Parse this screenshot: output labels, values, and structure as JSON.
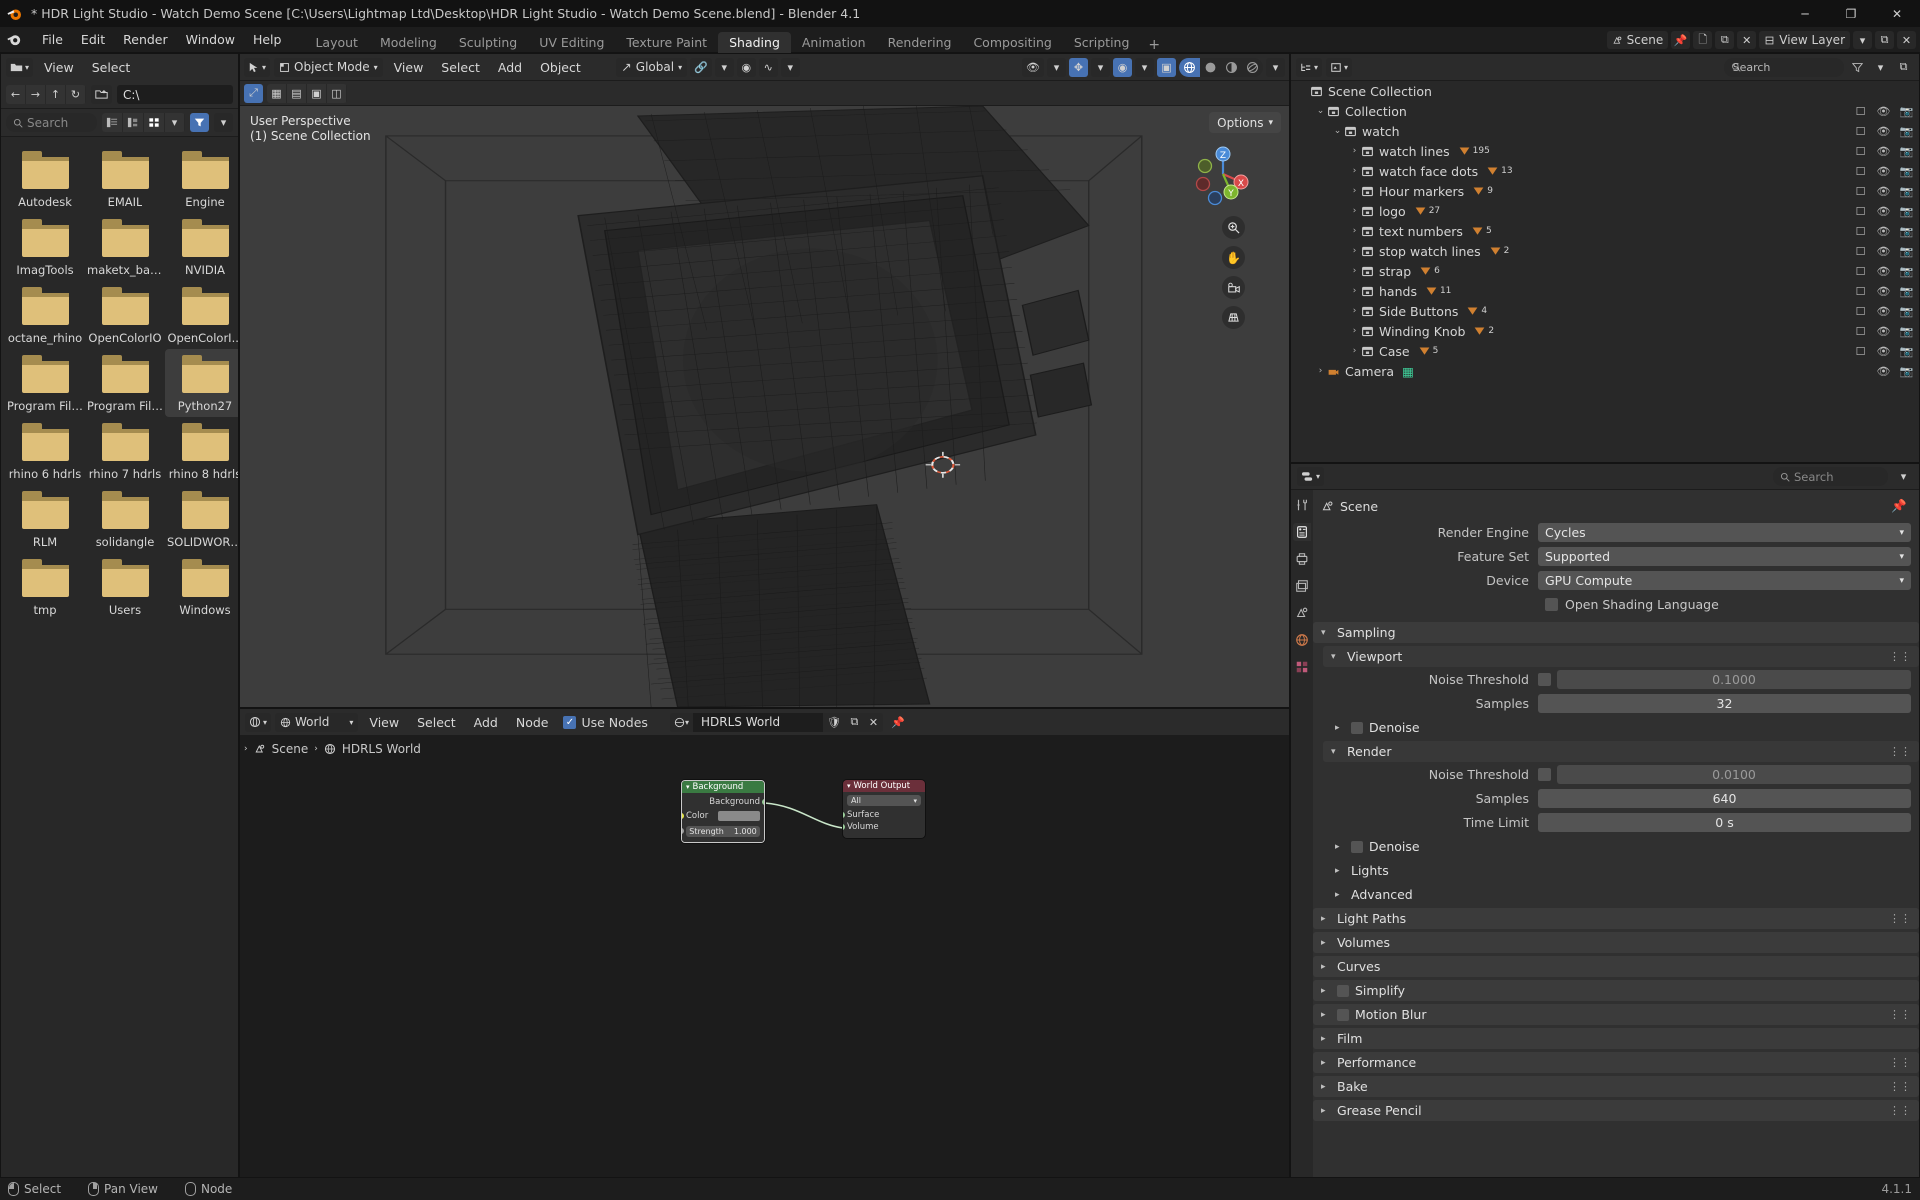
{
  "window": {
    "title": "* HDR Light Studio - Watch Demo Scene [C:\\Users\\Lightmap Ltd\\Desktop\\HDR Light Studio - Watch Demo Scene.blend] - Blender 4.1",
    "minimize": "─",
    "maximize": "❐",
    "close": "✕"
  },
  "topbar": {
    "menus": [
      "File",
      "Edit",
      "Render",
      "Window",
      "Help"
    ],
    "workspaces": [
      {
        "label": "Layout",
        "active": false
      },
      {
        "label": "Modeling",
        "active": false
      },
      {
        "label": "Sculpting",
        "active": false
      },
      {
        "label": "UV Editing",
        "active": false
      },
      {
        "label": "Texture Paint",
        "active": false
      },
      {
        "label": "Shading",
        "active": true
      },
      {
        "label": "Animation",
        "active": false
      },
      {
        "label": "Rendering",
        "active": false
      },
      {
        "label": "Compositing",
        "active": false
      },
      {
        "label": "Scripting",
        "active": false
      }
    ],
    "add_workspace": "+",
    "scene_name": "Scene",
    "view_layer_name": "View Layer"
  },
  "filebrowser": {
    "editor_menu": "folder-dropdown",
    "menus": [
      "View",
      "Select"
    ],
    "nav": {
      "back": "←",
      "forward": "→",
      "up": "↑",
      "refresh": "↻",
      "new_folder": "new-folder"
    },
    "path": "C:\\",
    "search_placeholder": "Search",
    "display_modes": [
      "list-vertical",
      "list-horizontal",
      "thumbnail-grid"
    ],
    "active_display_mode": "thumbnail-grid",
    "filter_enabled": true,
    "items": [
      {
        "name": "Autodesk",
        "selected": false
      },
      {
        "name": "EMAIL",
        "selected": false
      },
      {
        "name": "Engine",
        "selected": false
      },
      {
        "name": "ImagTools",
        "selected": false
      },
      {
        "name": "maketx_batc...",
        "selected": false
      },
      {
        "name": "NVIDIA",
        "selected": false
      },
      {
        "name": "octane_rhino",
        "selected": false
      },
      {
        "name": "OpenColorIO",
        "selected": false
      },
      {
        "name": "OpenColorI...",
        "selected": false
      },
      {
        "name": "Program Files",
        "selected": false
      },
      {
        "name": "Program File...",
        "selected": false
      },
      {
        "name": "Python27",
        "selected": true
      },
      {
        "name": "rhino 6 hdrls",
        "selected": false
      },
      {
        "name": "rhino 7 hdrls",
        "selected": false
      },
      {
        "name": "rhino 8 hdrls",
        "selected": false
      },
      {
        "name": "RLM",
        "selected": false
      },
      {
        "name": "solidangle",
        "selected": false
      },
      {
        "name": "SOLIDWORK...",
        "selected": false
      },
      {
        "name": "tmp",
        "selected": false
      },
      {
        "name": "Users",
        "selected": false
      },
      {
        "name": "Windows",
        "selected": false
      }
    ]
  },
  "viewport": {
    "mode": "Object Mode",
    "menus": [
      "View",
      "Select",
      "Add",
      "Object"
    ],
    "transform_orientation": "Global",
    "options_label": "Options",
    "overlay_line1": "User Perspective",
    "overlay_line2": "(1) Scene Collection",
    "gizmo_axes": [
      "X",
      "Y",
      "Z"
    ],
    "nav_tools": [
      "zoom-icon",
      "hand-icon",
      "camera-icon",
      "grid-icon"
    ]
  },
  "shader_editor": {
    "shader_type": "World",
    "menus": [
      "View",
      "Select",
      "Add",
      "Node"
    ],
    "use_nodes_label": "Use Nodes",
    "use_nodes_checked": true,
    "world_name": "HDRLS World",
    "breadcrumb": [
      "Scene",
      "HDRLS World"
    ],
    "nodes": [
      {
        "title": "Background",
        "output_label": "Background",
        "inputs": [
          {
            "label": "Color",
            "type": "color"
          },
          {
            "label": "Strength",
            "value": "1.000",
            "type": "value"
          }
        ]
      },
      {
        "title": "World Output",
        "dropdown": "All",
        "inputs": [
          {
            "label": "Surface"
          },
          {
            "label": "Volume"
          }
        ]
      }
    ]
  },
  "outliner": {
    "search_placeholder": "Search",
    "rows": [
      {
        "label": "Scene Collection",
        "indent": 0,
        "chev": "",
        "count": "",
        "icons": false
      },
      {
        "label": "Collection",
        "indent": 1,
        "chev": "⌄",
        "count": "",
        "icons": true
      },
      {
        "label": "watch",
        "indent": 2,
        "chev": "⌄",
        "count": "",
        "icons": true
      },
      {
        "label": "watch lines",
        "indent": 3,
        "chev": "›",
        "count": "195",
        "icons": true
      },
      {
        "label": "watch face dots",
        "indent": 3,
        "chev": "›",
        "count": "13",
        "icons": true
      },
      {
        "label": "Hour markers",
        "indent": 3,
        "chev": "›",
        "count": "9",
        "icons": true
      },
      {
        "label": "logo",
        "indent": 3,
        "chev": "›",
        "count": "27",
        "icons": true
      },
      {
        "label": "text numbers",
        "indent": 3,
        "chev": "›",
        "count": "5",
        "icons": true
      },
      {
        "label": "stop watch lines",
        "indent": 3,
        "chev": "›",
        "count": "2",
        "icons": true
      },
      {
        "label": "strap",
        "indent": 3,
        "chev": "›",
        "count": "6",
        "icons": true
      },
      {
        "label": "hands",
        "indent": 3,
        "chev": "›",
        "count": "11",
        "icons": true
      },
      {
        "label": "Side Buttons",
        "indent": 3,
        "chev": "›",
        "count": "4",
        "icons": true
      },
      {
        "label": "Winding Knob",
        "indent": 3,
        "chev": "›",
        "count": "2",
        "icons": true
      },
      {
        "label": "Case",
        "indent": 3,
        "chev": "›",
        "count": "5",
        "icons": true
      },
      {
        "label": "Camera",
        "indent": 1,
        "chev": "›",
        "count": "",
        "icons": true,
        "type": "camera"
      }
    ]
  },
  "properties": {
    "search_placeholder": "Search",
    "breadcrumb": "Scene",
    "tabs": [
      "tool-icon",
      "render-icon",
      "output-icon",
      "viewlayer-icon",
      "scene-icon",
      "world-icon",
      "texture-icon"
    ],
    "active_tab_index": 1,
    "fields": [
      {
        "label": "Render Engine",
        "value": "Cycles"
      },
      {
        "label": "Feature Set",
        "value": "Supported"
      },
      {
        "label": "Device",
        "value": "GPU Compute"
      }
    ],
    "osl_label": "Open Shading Language",
    "osl_checked": false,
    "sampling": {
      "title": "Sampling",
      "viewport": {
        "title": "Viewport",
        "noise_threshold_label": "Noise Threshold",
        "noise_threshold_value": "0.1000",
        "noise_threshold_enabled": false,
        "samples_label": "Samples",
        "samples_value": "32",
        "denoise_label": "Denoise"
      },
      "render": {
        "title": "Render",
        "noise_threshold_label": "Noise Threshold",
        "noise_threshold_value": "0.0100",
        "noise_threshold_enabled": false,
        "samples_label": "Samples",
        "samples_value": "640",
        "time_limit_label": "Time Limit",
        "time_limit_value": "0 s",
        "denoise_label": "Denoise"
      },
      "lights_label": "Lights",
      "advanced_label": "Advanced"
    },
    "sections": [
      "Light Paths",
      "Volumes",
      "Curves",
      "Simplify",
      "Motion Blur",
      "Film",
      "Performance",
      "Bake",
      "Grease Pencil"
    ]
  },
  "statusbar": {
    "select_label": "Select",
    "pan_label": "Pan View",
    "node_label": "Node",
    "version": "4.1.1"
  }
}
